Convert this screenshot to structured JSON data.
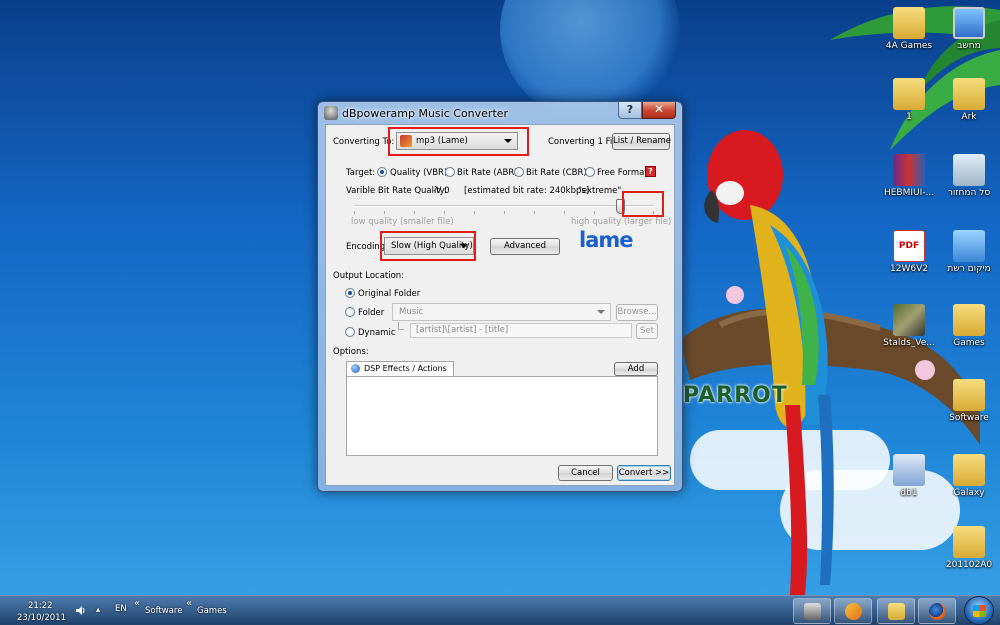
{
  "window": {
    "title": "dBpoweramp Music Converter",
    "help_label": "?",
    "close_label": "✕"
  },
  "converter": {
    "converting_to_label": "Converting To:",
    "format_value": "mp3 (Lame)",
    "converting_count": "Converting 1 File",
    "list_rename_label": "List / Rename",
    "target_label": "Target:",
    "target_options": [
      "Quality (VBR)",
      "Bit Rate (ABR)",
      "Bit Rate (CBR)",
      "Free Format"
    ],
    "target_selected": "Quality (VBR)",
    "help_icon_label": "?",
    "vbr_label": "Varible Bit Rate Quality:",
    "vbr_value": "-V 0",
    "estimated_bitrate": "[estimated bit rate: 240kbps]",
    "quality_name": "\"extreme\"",
    "slider_min_label": "low quality (smaller file)",
    "slider_max_label": "high quality (larger file)",
    "slider_level": 0.9,
    "encoding_label": "Encoding:",
    "encoding_value": "Slow (High Quality)",
    "advanced_label": "Advanced",
    "encoder_logo": "lame"
  },
  "output": {
    "section_label": "Output Location:",
    "original_folder_label": "Original Folder",
    "folder_label": "Folder",
    "folder_value": "Music",
    "browse_label": "Browse...",
    "dynamic_label": "Dynamic",
    "dynamic_value": "[artist]\\[artist] - [title]",
    "set_label": "Set",
    "selected": "Original Folder"
  },
  "options": {
    "section_label": "Options:",
    "tab_label": "DSP Effects / Actions",
    "add_label": "Add"
  },
  "footer": {
    "cancel_label": "Cancel",
    "convert_label": "Convert >>"
  },
  "desktop": {
    "icons": [
      {
        "label": "4A Games",
        "icon": "folder-icon"
      },
      {
        "label": "מחשב",
        "icon": "computer-icon"
      },
      {
        "label": "1",
        "icon": "folder-icon"
      },
      {
        "label": "Ark",
        "icon": "folder-icon"
      },
      {
        "label": "HEBMIUI-...",
        "icon": "rar-archive-icon"
      },
      {
        "label": "סל המחזור",
        "icon": "recycle-bin-icon"
      },
      {
        "label": "12W6V2",
        "icon": "pdf-icon"
      },
      {
        "label": "מיקום רשת",
        "icon": "network-icon"
      },
      {
        "label": "Stalds_Ve...",
        "icon": "photo-icon"
      },
      {
        "label": "Games",
        "icon": "folder-icon"
      },
      {
        "label": "Software",
        "icon": "folder-icon"
      },
      {
        "label": "db1",
        "icon": "document-icon"
      },
      {
        "label": "Galaxy",
        "icon": "folder-icon"
      },
      {
        "label": "201102A0",
        "icon": "folder-icon"
      }
    ],
    "wallpaper_text": "PARROT"
  },
  "taskbar": {
    "time": "21:22",
    "date": "23/10/2011",
    "language": "EN",
    "breadcrumb_sep": "«",
    "toolbar_items": [
      "Software",
      "Games"
    ]
  },
  "colors": {
    "highlight": "#e31b1b",
    "lame_blue": "#1a5fd0",
    "accent": "#3c7fb1"
  }
}
